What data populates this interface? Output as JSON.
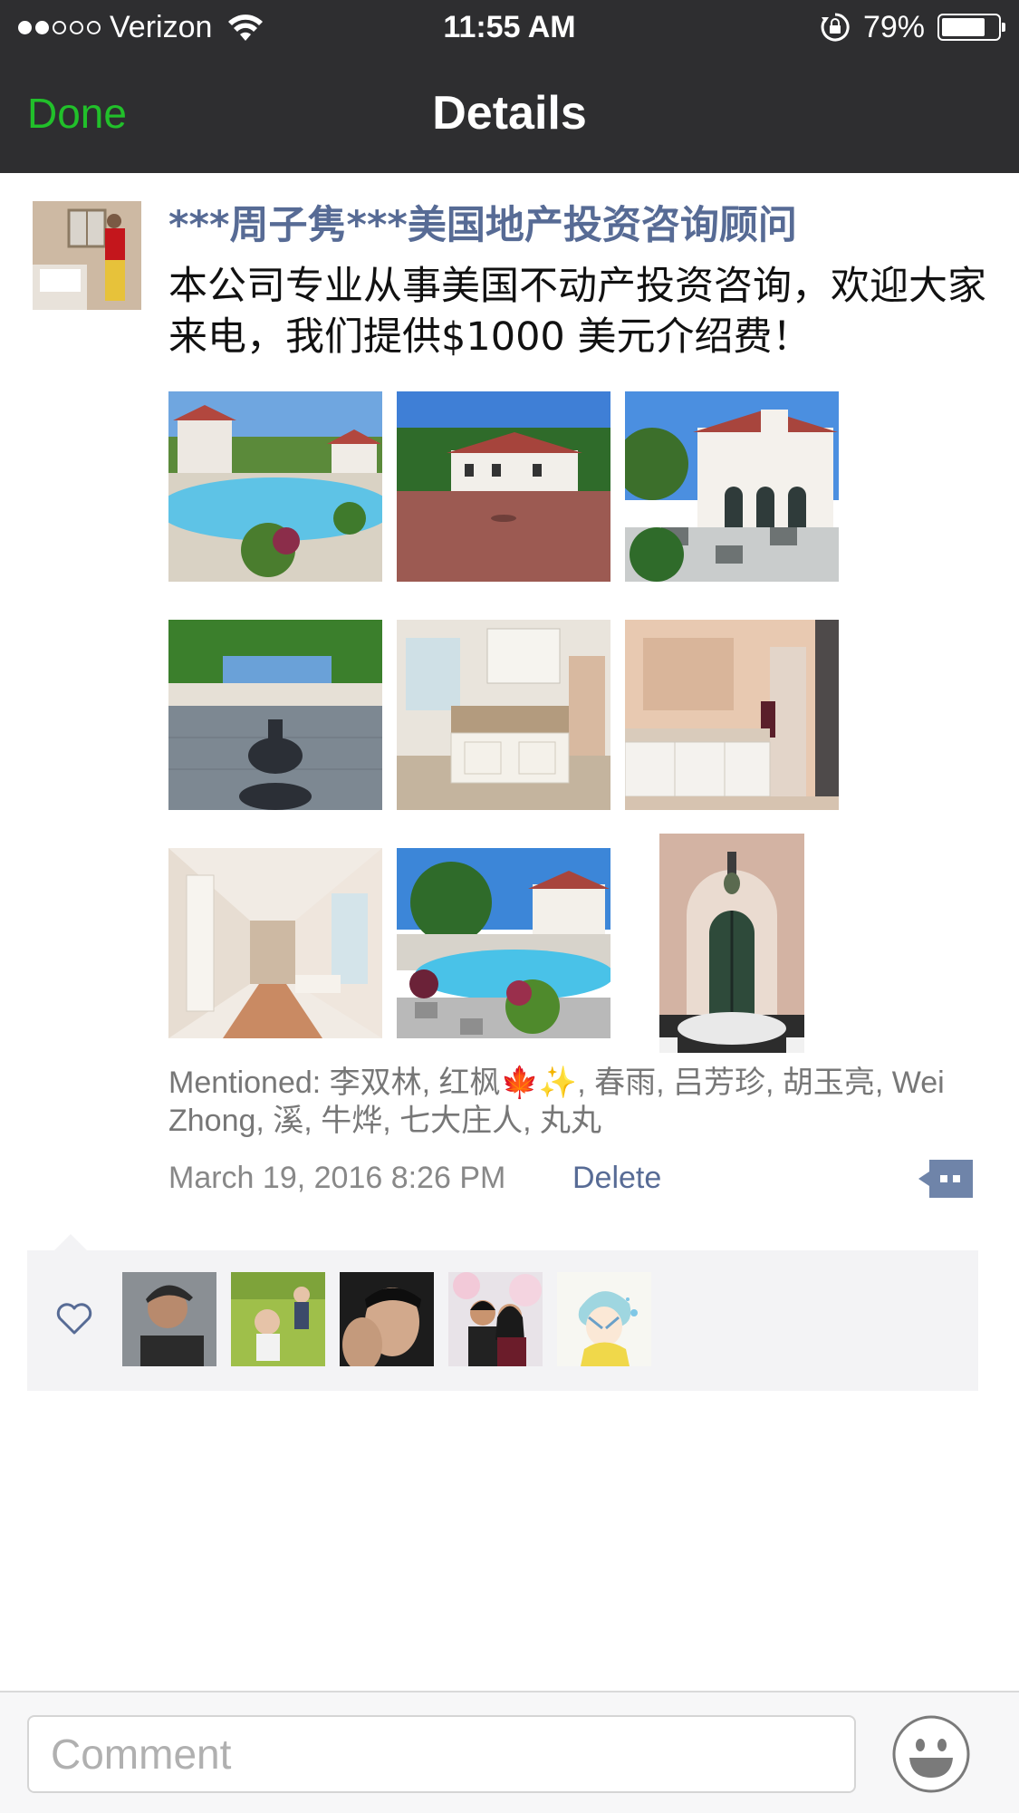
{
  "status_bar": {
    "carrier": "Verizon",
    "time": "11:55 AM",
    "battery_percent": "79%",
    "battery_level": 0.79
  },
  "nav": {
    "done_label": "Done",
    "title": "Details"
  },
  "post": {
    "author": "***周子隽***美国地产投资咨询顾问",
    "text": "本公司专业从事美国不动产投资咨询，欢迎大家来电，我们提供$1000 美元介绍费！",
    "photos_count": 9,
    "mentioned": "Mentioned: 李双林, 红枫🍁✨, 春雨, 吕芳珍, 胡玉亮, Wei Zhong, 溪, 牛烨, 七大庄人, 丸丸",
    "timestamp": "March 19, 2016 8:26 PM",
    "delete_label": "Delete"
  },
  "likes": {
    "icon": "heart-outline-icon",
    "count_avatars": 5
  },
  "comment_bar": {
    "placeholder": "Comment",
    "emoji_icon": "smiley-icon"
  },
  "colors": {
    "nav_bg": "#2e2e30",
    "done_green": "#21c02a",
    "link_blue": "#576b95",
    "likes_bg": "#f3f3f5"
  }
}
